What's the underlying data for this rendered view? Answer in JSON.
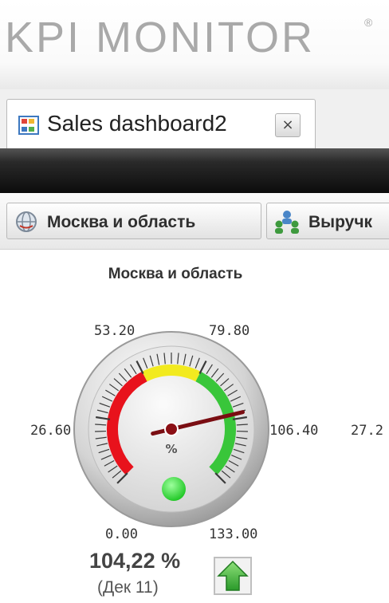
{
  "app": {
    "logo_text": "KPI MONITOR",
    "logo_mark": "®"
  },
  "tabs": [
    {
      "label": "Sales dashboard2",
      "close_symbol": "×",
      "icon": "dashboard-grid-icon"
    }
  ],
  "filters": [
    {
      "label": "Москва и область",
      "icon": "globe-icon"
    },
    {
      "label": "Выручк",
      "icon": "people-group-icon"
    }
  ],
  "gauge": {
    "title": "Москва и область",
    "unit": "%",
    "tick_labels": [
      "0.00",
      "26.60",
      "53.20",
      "79.80",
      "106.40",
      "133.00"
    ],
    "min": 0,
    "max": 133,
    "needle_value": 104.22,
    "value_text": "104,22 %",
    "period_text": "(Дек 11)",
    "zones": [
      {
        "from": 0,
        "to": 53.2,
        "color": "#e8121c"
      },
      {
        "from": 53.2,
        "to": 79.8,
        "color": "#f2ea1f"
      },
      {
        "from": 79.8,
        "to": 133,
        "color": "#39c63a"
      }
    ],
    "status_color": "#2fe03a",
    "trend_icon": "arrow-up-icon"
  },
  "next_gauge": {
    "partial_label": "27.2"
  }
}
